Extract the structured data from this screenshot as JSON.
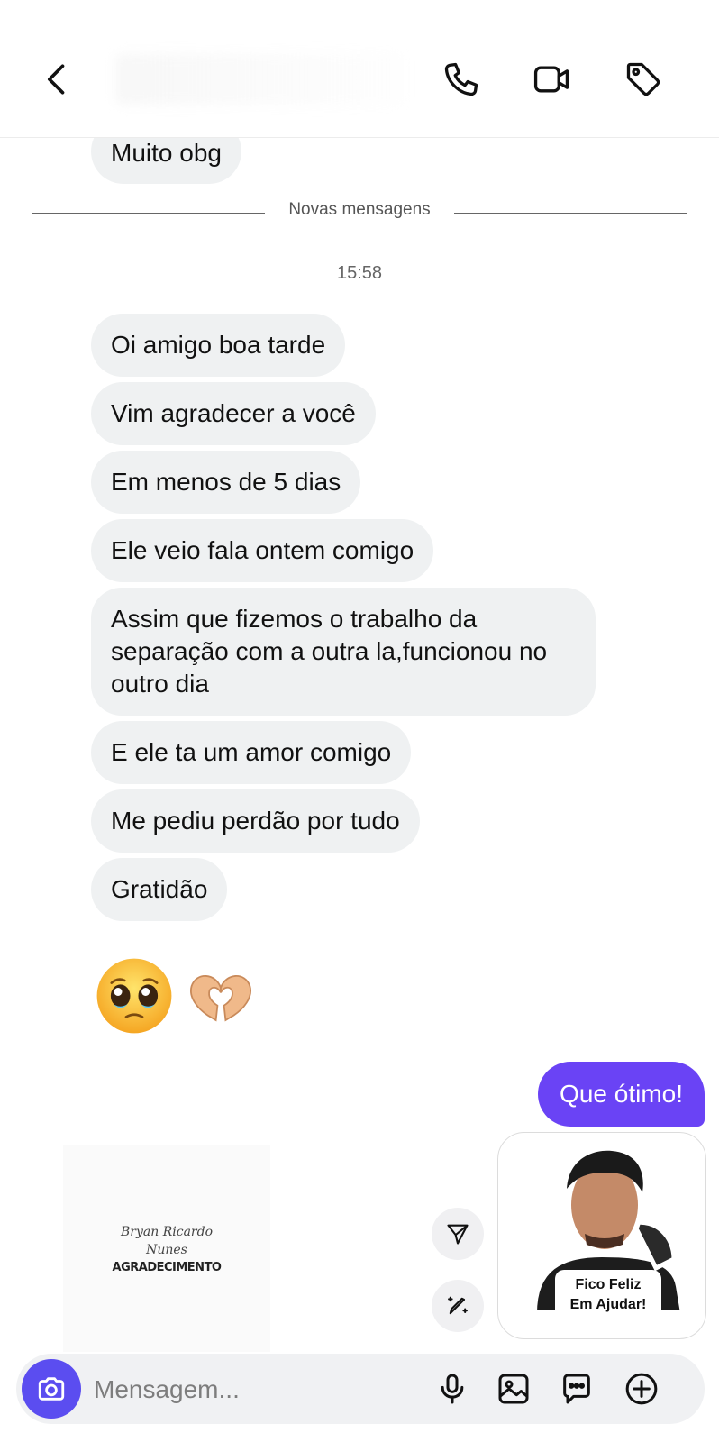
{
  "header": {
    "back_icon": "chevron-left-icon",
    "call_icon": "phone-icon",
    "video_icon": "video-camera-icon",
    "tag_icon": "tag-icon"
  },
  "messages": {
    "top_partial": "Muito obg",
    "divider_label": "Novas mensagens",
    "timestamp": "15:58",
    "incoming": [
      "Oi amigo boa tarde",
      "Vim agradecer a você",
      "Em menos de 5 dias",
      "Ele veio fala ontem comigo",
      "Assim que fizemos o trabalho da separação com a outra la,funcionou no outro dia",
      "E ele ta um amor comigo",
      "Me pediu perdão por tudo",
      "Gratidão"
    ],
    "emojis": [
      "pleading-face-emoji",
      "heart-hands-emoji"
    ],
    "outgoing": "Que ótimo!"
  },
  "shared_card": {
    "script_line1": "Bryan Ricardo",
    "script_line2": "Nunes",
    "label": "AGRADECIMENTO"
  },
  "sticker": {
    "line1": "Fico Feliz",
    "line2": "Em Ajudar!"
  },
  "composer": {
    "placeholder": "Mensagem...",
    "camera_icon": "camera-icon",
    "mic_icon": "microphone-icon",
    "gallery_icon": "image-icon",
    "chat_icon": "chat-bubble-icon",
    "add_icon": "plus-circle-icon"
  },
  "colors": {
    "accent": "#6a43f5",
    "camera_button": "#5b4df0",
    "incoming_bubble": "#eff1f2"
  }
}
